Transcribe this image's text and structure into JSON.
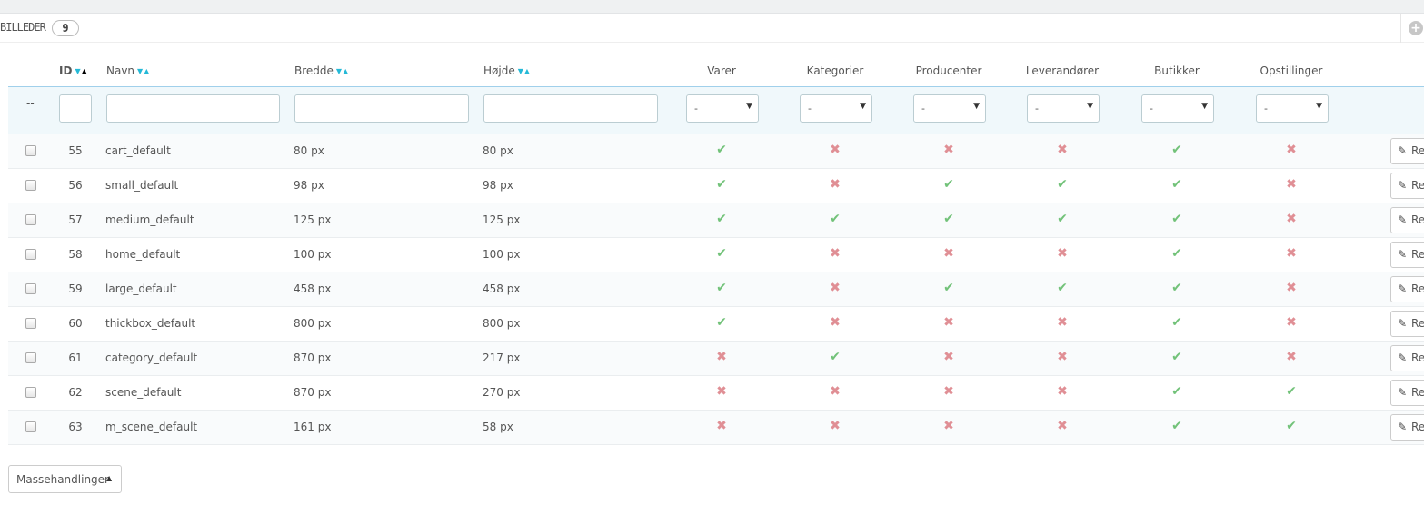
{
  "panel": {
    "title": "BILLEDER",
    "count": "9"
  },
  "headers": {
    "id": "ID",
    "name": "Navn",
    "width": "Bredde",
    "height": "Højde",
    "products": "Varer",
    "categories": "Kategorier",
    "manufacturers": "Producenter",
    "suppliers": "Leverandører",
    "stores": "Butikker",
    "scenes": "Opstillinger"
  },
  "filters": {
    "reset_text": "--",
    "select_value": "-"
  },
  "rows": [
    {
      "id": "55",
      "name": "cart_default",
      "width": "80 px",
      "height": "80 px",
      "flags": [
        true,
        false,
        false,
        false,
        true,
        false
      ]
    },
    {
      "id": "56",
      "name": "small_default",
      "width": "98 px",
      "height": "98 px",
      "flags": [
        true,
        false,
        true,
        true,
        true,
        false
      ]
    },
    {
      "id": "57",
      "name": "medium_default",
      "width": "125 px",
      "height": "125 px",
      "flags": [
        true,
        true,
        true,
        true,
        true,
        false
      ]
    },
    {
      "id": "58",
      "name": "home_default",
      "width": "100 px",
      "height": "100 px",
      "flags": [
        true,
        false,
        false,
        false,
        true,
        false
      ]
    },
    {
      "id": "59",
      "name": "large_default",
      "width": "458 px",
      "height": "458 px",
      "flags": [
        true,
        false,
        true,
        true,
        true,
        false
      ]
    },
    {
      "id": "60",
      "name": "thickbox_default",
      "width": "800 px",
      "height": "800 px",
      "flags": [
        true,
        false,
        false,
        false,
        true,
        false
      ]
    },
    {
      "id": "61",
      "name": "category_default",
      "width": "870 px",
      "height": "217 px",
      "flags": [
        false,
        true,
        false,
        false,
        true,
        false
      ]
    },
    {
      "id": "62",
      "name": "scene_default",
      "width": "870 px",
      "height": "270 px",
      "flags": [
        false,
        false,
        false,
        false,
        true,
        true
      ]
    },
    {
      "id": "63",
      "name": "m_scene_default",
      "width": "161 px",
      "height": "58 px",
      "flags": [
        false,
        false,
        false,
        false,
        true,
        true
      ]
    }
  ],
  "row_action": {
    "edit_label": "Re"
  },
  "bulk": {
    "label": "Massehandlinger"
  },
  "icons": {
    "check": "check-icon",
    "cross": "cross-icon",
    "pencil": "pencil-icon",
    "add": "add-circle-icon"
  },
  "colors": {
    "check": "#72c279",
    "cross": "#e08f95",
    "sort_accent": "#25b9d7"
  }
}
